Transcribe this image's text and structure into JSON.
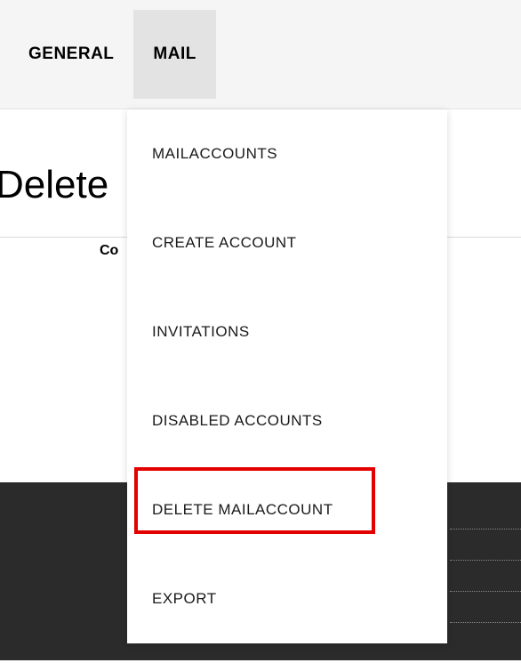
{
  "tabs": {
    "general": "GENERAL",
    "mail": "MAIL"
  },
  "page": {
    "title": "Delete",
    "confirm_label_partial": "Co"
  },
  "dropdown": {
    "items": [
      "MAILACCOUNTS",
      "CREATE ACCOUNT",
      "INVITATIONS",
      "DISABLED ACCOUNTS",
      "DELETE MAILACCOUNT",
      "EXPORT"
    ]
  }
}
